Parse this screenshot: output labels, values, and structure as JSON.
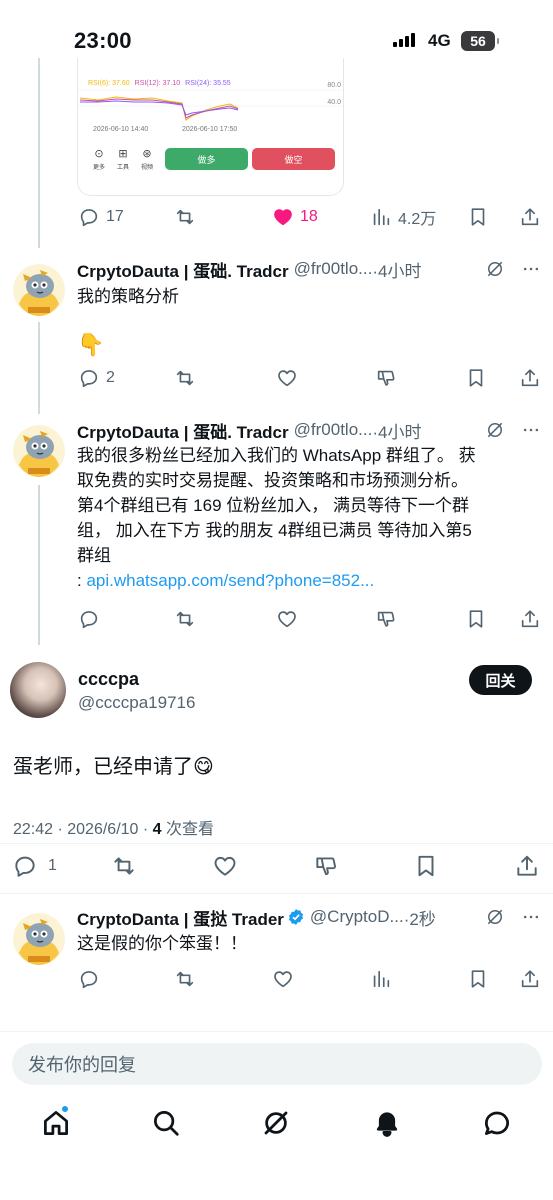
{
  "status_bar": {
    "time": "23:00",
    "network": "4G",
    "battery": "56"
  },
  "chart_card": {
    "rsi_labels": [
      "RSI(6): 37.60",
      "RSI(12): 37.10",
      "RSI(24): 35.55"
    ],
    "scale_top": "80.0",
    "scale_mid": "40.0",
    "date_left": "2026-06-10 14:40",
    "date_right": "2026-06-10 17:50",
    "tools": [
      {
        "icon": "more-icon",
        "label": "更多"
      },
      {
        "icon": "tools-icon",
        "label": "工具"
      },
      {
        "icon": "view-icon",
        "label": "视频"
      }
    ],
    "buy_label": "做多",
    "sell_label": "做空"
  },
  "tweet1_actions": {
    "replies": "17",
    "likes": "18",
    "views": "4.2万"
  },
  "tweet2": {
    "name": "CrpytoDauta | 蛋础. Tradcr",
    "handle": "@fr00tlo...",
    "time": "·4小时",
    "text": "我的策略分析",
    "emoji": "👇",
    "replies": "2"
  },
  "tweet3": {
    "name": "CrpytoDauta | 蛋础. Tradcr",
    "handle": "@fr00tlo...",
    "time": "·4小时",
    "lines": [
      "我的很多粉丝已经加入我们的 WhatsApp 群组了。 获",
      "取免费的实时交易提醒、投资策略和市场预测分析。",
      "第4个群组已有 169 位粉丝加入， 满员等待下一个群",
      "组， 加入在下方 我的朋友 4群组已满员 等待加入第5",
      "群组"
    ],
    "link_prefix": ": ",
    "link": "api.whatsapp.com/send?phone=852..."
  },
  "main_tweet": {
    "name": "ccccpa",
    "handle": "@ccccpa19716",
    "follow_label": "回关",
    "text": "蛋老师，已经申请了😋",
    "timestamp": "22:42 · 2026/6/10 · ",
    "views_count": "4",
    "views_label": " 次查看",
    "replies": "1"
  },
  "reply_tweet": {
    "name": "CryptoDanta | 蛋挞 Trader",
    "handle": "@CryptoD...",
    "time": "·2秒",
    "text": "这是假的你个笨蛋！！"
  },
  "reply_box": {
    "placeholder": "发布你的回复"
  },
  "bottom_nav": [
    "home-icon",
    "search-icon",
    "grok-icon",
    "notifications-icon",
    "messages-icon"
  ],
  "colors": {
    "like": "#f91880",
    "link": "#1d9bf0",
    "buy": "#3eaa6a",
    "sell": "#e0505f"
  }
}
